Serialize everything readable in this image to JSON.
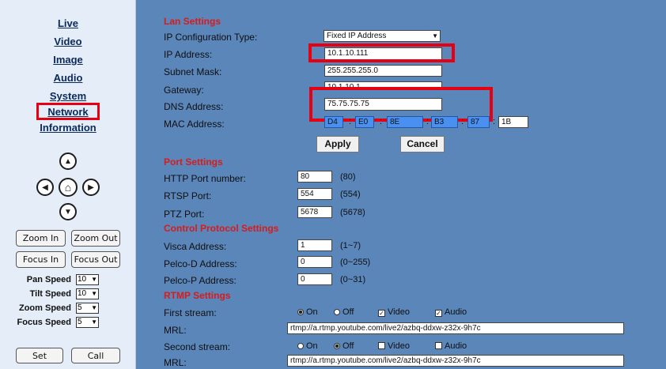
{
  "nav": {
    "live": "Live",
    "video": "Video",
    "image": "Image",
    "audio": "Audio",
    "system": "System",
    "network": "Network",
    "information": "Information"
  },
  "ptz": {
    "up": "▲",
    "left": "◀",
    "home": "⌂",
    "right": "▶",
    "down": "▼"
  },
  "buttons": {
    "zoom_in": "Zoom In",
    "zoom_out": "Zoom Out",
    "focus_in": "Focus In",
    "focus_out": "Focus Out",
    "set": "Set",
    "call": "Call"
  },
  "speeds": {
    "pan_label": "Pan Speed",
    "pan_value": "10",
    "tilt_label": "Tilt Speed",
    "tilt_value": "10",
    "zoom_label": "Zoom Speed",
    "zoom_value": "5",
    "focus_label": "Focus Speed",
    "focus_value": "5"
  },
  "lan": {
    "heading": "Lan Settings",
    "ip_config_label": "IP Configuration Type:",
    "ip_config_value": "Fixed IP Address",
    "ip_label": "IP Address:",
    "ip_value": "10.1.10.111",
    "subnet_label": "Subnet Mask:",
    "subnet_value": "255.255.255.0",
    "gateway_label": "Gateway:",
    "gateway_value": "10.1.10.1",
    "dns_label": "DNS Address:",
    "dns_value": "75.75.75.75",
    "mac_label": "MAC Address:",
    "mac": [
      "D4",
      "E0",
      "8E",
      "B3",
      "87",
      "1B"
    ],
    "mac_sep": ":",
    "apply": "Apply",
    "cancel": "Cancel"
  },
  "ports": {
    "heading": "Port Settings",
    "http_label": "HTTP Port number:",
    "http_value": "80",
    "http_hint": "(80)",
    "rtsp_label": "RTSP Port:",
    "rtsp_value": "554",
    "rtsp_hint": "(554)",
    "ptz_label": "PTZ Port:",
    "ptz_value": "5678",
    "ptz_hint": "(5678)"
  },
  "control": {
    "heading": "Control Protocol Settings",
    "visca_label": "Visca Address:",
    "visca_value": "1",
    "visca_hint": "(1~7)",
    "pelcod_label": "Pelco-D Address:",
    "pelcod_value": "0",
    "pelcod_hint": "(0~255)",
    "pelcop_label": "Pelco-P Address:",
    "pelcop_value": "0",
    "pelcop_hint": "(0~31)"
  },
  "rtmp": {
    "heading": "RTMP Settings",
    "first_label": "First stream:",
    "on": "On",
    "off": "Off",
    "video": "Video",
    "audio": "Audio",
    "check_mark": "✓",
    "mrl_label": "MRL:",
    "first_mrl": "rtmp://a.rtmp.youtube.com/live2/azbq-ddxw-z32x-9h7c",
    "second_label": "Second stream:",
    "second_mrl": "rtmp://a.rtmp.youtube.com/live2/azbq-ddxw-z32x-9h7c"
  },
  "colors": {
    "main_bg": "#5a86ba",
    "sidebar_bg": "#e4edf8",
    "heading_red": "#d81b1b",
    "highlight_red": "#e50012",
    "mac_blue": "#4a90f0"
  }
}
